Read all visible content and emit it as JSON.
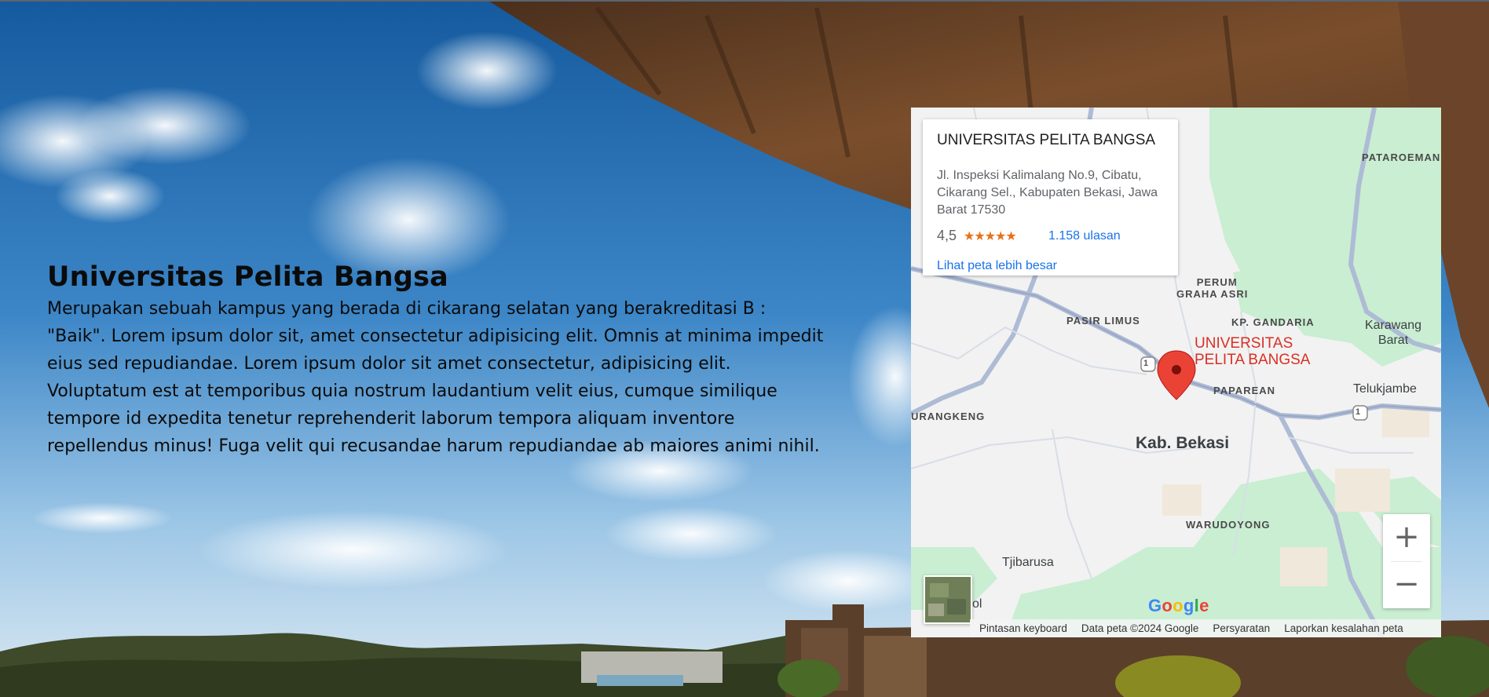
{
  "hero": {
    "title": "Universitas Pelita Bangsa",
    "description": "Merupakan sebuah kampus yang berada di cikarang selatan yang berakreditasi B : \"Baik\". Lorem ipsum dolor sit, amet consectetur adipisicing elit. Omnis at minima impedit eius sed repudiandae. Lorem ipsum dolor sit amet consectetur, adipisicing elit. Voluptatum est at temporibus quia nostrum laudantium velit eius, cumque similique tempore id expedita tenetur reprehenderit laborum tempora aliquam inventore repellendus minus! Fuga velit qui recusandae harum repudiandae ab maiores animi nihil."
  },
  "map": {
    "info_card": {
      "title": "UNIVERSITAS PELITA BANGSA",
      "address": "Jl. Inspeksi Kalimalang No.9, Cibatu, Cikarang Sel., Kabupaten Bekasi, Jawa Barat 17530",
      "rating": "4,5",
      "stars": "★★★★★",
      "reviews": "1.158 ulasan",
      "larger_map_link": "Lihat peta lebih besar"
    },
    "labels": {
      "pataroeman": "PATAROEMAN",
      "perum_graha_asri": [
        "PERUM",
        "GRAHA ASRI"
      ],
      "pasir_limus": "PASIR LIMUS",
      "kp_gandaria": "KP. GANDARIA",
      "karawang_barat": [
        "Karawang",
        "Barat"
      ],
      "paparean": "PAPAREAN",
      "telukjambe": "Telukjambe",
      "urangkeng": "URANGKENG",
      "kab_bekasi": "Kab. Bekasi",
      "warudoyong": "WARUDOYONG",
      "tjibarusa": "Tjibarusa",
      "partial_ol": "ol",
      "route_shield": "1",
      "place_name": [
        "UNIVERSITAS",
        "PELITA BANGSA"
      ]
    },
    "controls": {
      "zoom_in": "+",
      "zoom_out": "−"
    },
    "google_logo": [
      "G",
      "o",
      "o",
      "g",
      "l",
      "e"
    ],
    "attribution": {
      "keyboard": "Pintasan keyboard",
      "data": "Data peta ©2024 Google",
      "terms": "Persyaratan",
      "report": "Laporkan kesalahan peta"
    },
    "colors": {
      "pin": "#ea4335",
      "place_label": "#d93025",
      "link": "#1a73e8",
      "star": "#e7711b",
      "green_area": "#c9eed2",
      "road": "#9aaacf"
    }
  }
}
